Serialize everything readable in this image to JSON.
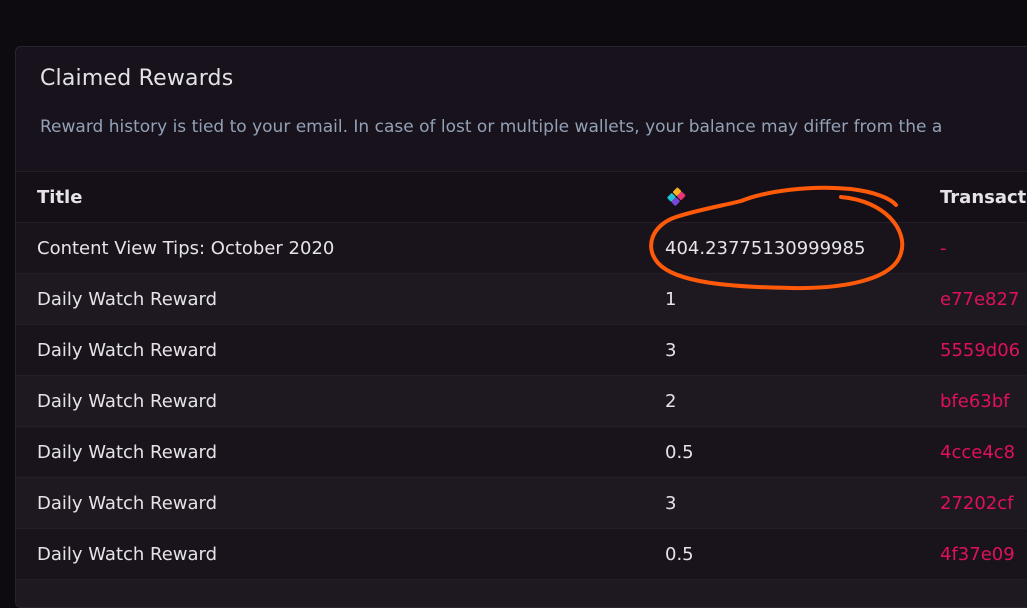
{
  "card": {
    "title": "Claimed Rewards",
    "subtitle": "Reward history is tied to your email. In case of lost or multiple wallets, your balance may differ from the a"
  },
  "table": {
    "columns": {
      "title": "Title",
      "amount_icon": "lbc-icon",
      "transaction": "Transacti"
    },
    "rows": [
      {
        "title": "Content View Tips: October 2020",
        "amount": "404.23775130999985",
        "transaction": "-"
      },
      {
        "title": "Daily Watch Reward",
        "amount": "1",
        "transaction": "e77e827"
      },
      {
        "title": "Daily Watch Reward",
        "amount": "3",
        "transaction": "5559d06"
      },
      {
        "title": "Daily Watch Reward",
        "amount": "2",
        "transaction": "bfe63bf"
      },
      {
        "title": "Daily Watch Reward",
        "amount": "0.5",
        "transaction": "4cce4c8"
      },
      {
        "title": "Daily Watch Reward",
        "amount": "3",
        "transaction": "27202cf"
      },
      {
        "title": "Daily Watch Reward",
        "amount": "0.5",
        "transaction": "4f37e09"
      },
      {
        "title": "",
        "amount": "",
        "transaction": ""
      }
    ]
  },
  "colors": {
    "background": "#0e0b10",
    "card": "#17121b",
    "link": "#e0105e",
    "subtitle": "#93a1b6",
    "annotation": "#ff5a0a"
  },
  "annotation": {
    "type": "hand-drawn-circle",
    "target": "row-0-amount"
  }
}
